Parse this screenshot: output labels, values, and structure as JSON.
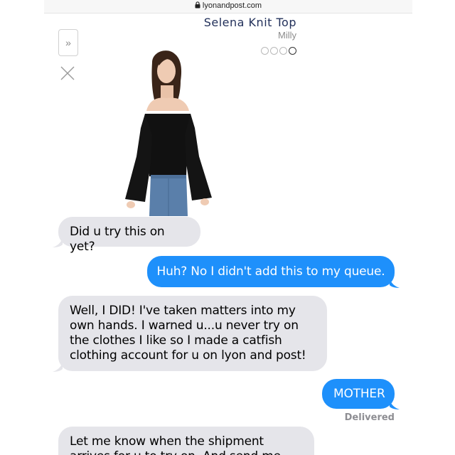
{
  "browser": {
    "url": "lyonandpost.com",
    "lock_icon": "lock-icon"
  },
  "product": {
    "title": "Selena Knit Top",
    "brand": "Milly",
    "image_dots": 4,
    "active_dot": 4,
    "expand_label": "»",
    "close_icon": "close-icon"
  },
  "messages": [
    {
      "direction": "incoming",
      "text": "Did u try this on yet?"
    },
    {
      "direction": "outgoing",
      "text": "Huh? No I didn't add this to my queue."
    },
    {
      "direction": "incoming",
      "text": "Well, I DID! I've taken matters into my own hands. I warned u...u never try on the clothes I like so I made a catfish clothing account for u on lyon and post!"
    },
    {
      "direction": "outgoing",
      "text": "MOTHER"
    },
    {
      "direction": "incoming",
      "text": "Let me know when the shipment arrives for u to try on. And send me pix!"
    }
  ],
  "delivery_status": "Delivered",
  "colors": {
    "incoming_bubble": "#e5e5ea",
    "outgoing_bubble": "#1e90fb",
    "product_title": "#22305a"
  }
}
